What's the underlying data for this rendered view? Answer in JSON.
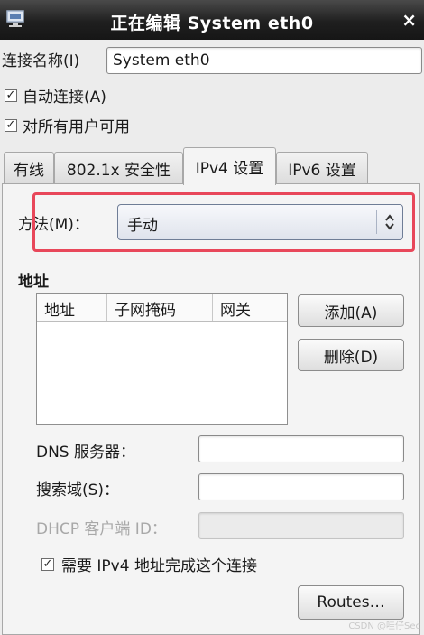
{
  "window": {
    "title": "正在编辑 System eth0",
    "close_glyph": "×"
  },
  "connection_name": {
    "label": "连接名称(I)",
    "value": "System eth0"
  },
  "checkboxes": {
    "auto_connect": {
      "label": "自动连接(A)",
      "checked": true
    },
    "all_users": {
      "label": "对所有用户可用",
      "checked": true
    }
  },
  "tabs": [
    {
      "label": "有线"
    },
    {
      "label": "802.1x 安全性"
    },
    {
      "label": "IPv4 设置",
      "active": true
    },
    {
      "label": "IPv6 设置"
    }
  ],
  "ipv4": {
    "method_label": "方法(M)：",
    "method_value": "手动",
    "addresses_heading": "地址",
    "table_headers": [
      "地址",
      "子网掩码",
      "网关"
    ],
    "add_button": "添加(A)",
    "delete_button": "删除(D)",
    "dns_label": "DNS 服务器：",
    "search_label": "搜索域(S)：",
    "dhcp_label": "DHCP 客户端 ID：",
    "require_ipv4": {
      "label": "需要 IPv4 地址完成这个连接",
      "checked": true
    },
    "routes_button": "Routes…"
  },
  "watermark": "CSDN @哇仔Sec",
  "colors": {
    "highlight": "#e8475a",
    "titlebar": "#1f1f1f"
  },
  "icons": {
    "app": "network-connection-icon",
    "combo": "updown-chevron-icon",
    "check": "checkmark-icon"
  }
}
